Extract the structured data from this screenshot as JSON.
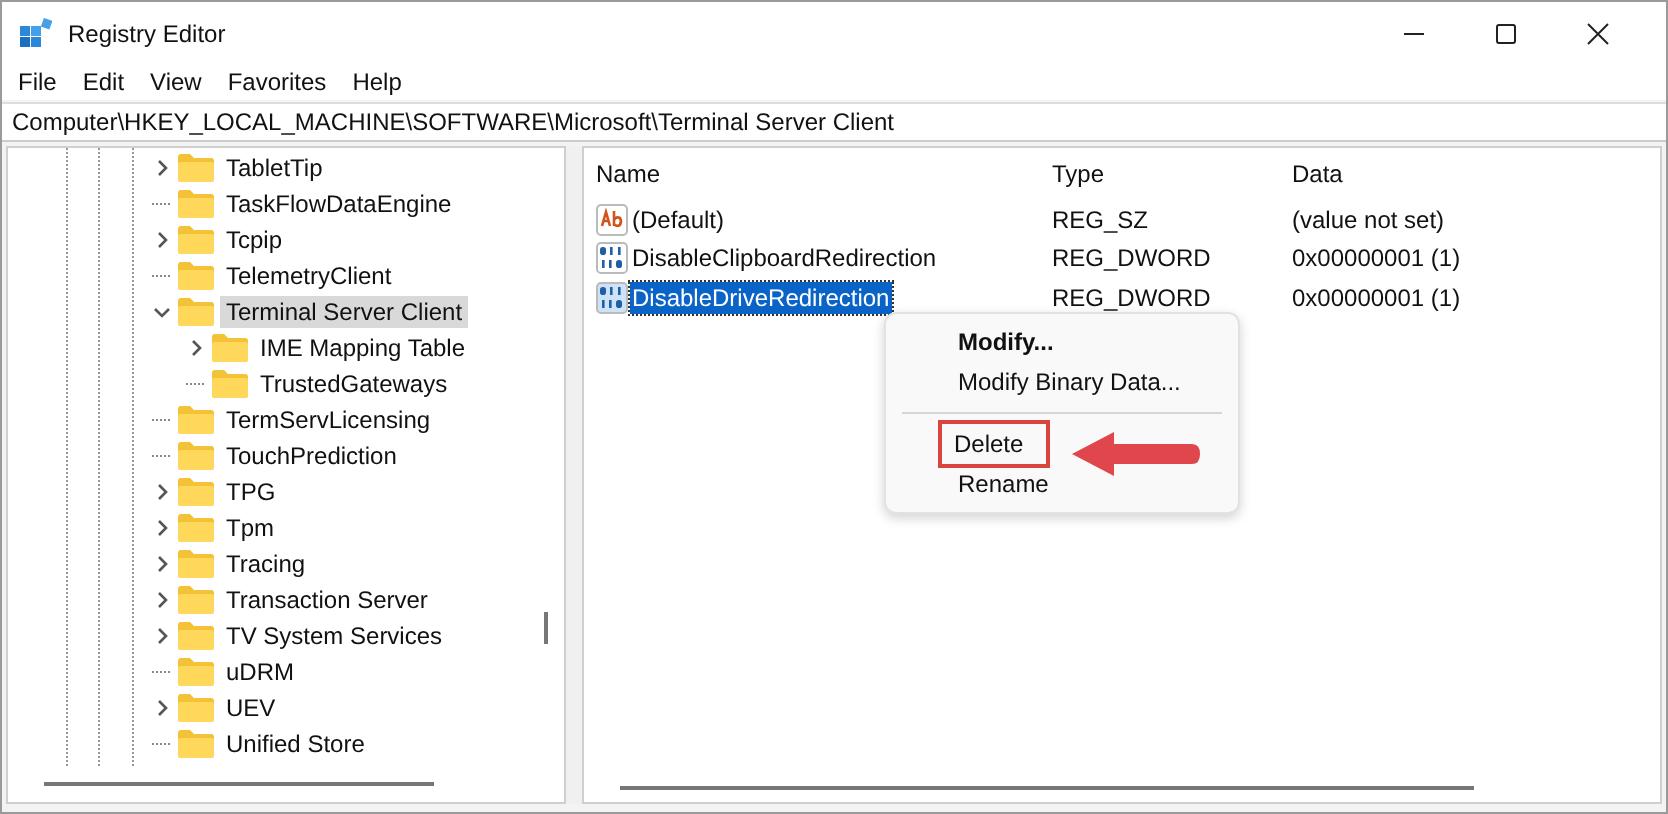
{
  "window": {
    "title": "Registry Editor"
  },
  "menu": [
    "File",
    "Edit",
    "View",
    "Favorites",
    "Help"
  ],
  "address": "Computer\\HKEY_LOCAL_MACHINE\\SOFTWARE\\Microsoft\\Terminal Server Client",
  "tree": [
    {
      "label": "TabletTip",
      "expandable": true,
      "expanded": false,
      "selected": false
    },
    {
      "label": "TaskFlowDataEngine",
      "expandable": false,
      "selected": false
    },
    {
      "label": "Tcpip",
      "expandable": true,
      "expanded": false,
      "selected": false
    },
    {
      "label": "TelemetryClient",
      "expandable": false,
      "selected": false
    },
    {
      "label": "Terminal Server Client",
      "expandable": true,
      "expanded": true,
      "selected": true,
      "children": [
        {
          "label": "IME Mapping Table",
          "expandable": true,
          "expanded": false,
          "selected": false
        },
        {
          "label": "TrustedGateways",
          "expandable": false,
          "selected": false
        }
      ]
    },
    {
      "label": "TermServLicensing",
      "expandable": false,
      "selected": false
    },
    {
      "label": "TouchPrediction",
      "expandable": false,
      "selected": false
    },
    {
      "label": "TPG",
      "expandable": true,
      "expanded": false,
      "selected": false
    },
    {
      "label": "Tpm",
      "expandable": true,
      "expanded": false,
      "selected": false
    },
    {
      "label": "Tracing",
      "expandable": true,
      "expanded": false,
      "selected": false
    },
    {
      "label": "Transaction Server",
      "expandable": true,
      "expanded": false,
      "selected": false
    },
    {
      "label": "TV System Services",
      "expandable": true,
      "expanded": false,
      "selected": false
    },
    {
      "label": "uDRM",
      "expandable": false,
      "selected": false
    },
    {
      "label": "UEV",
      "expandable": true,
      "expanded": false,
      "selected": false
    },
    {
      "label": "Unified Store",
      "expandable": false,
      "selected": false
    }
  ],
  "values": {
    "columns": [
      "Name",
      "Type",
      "Data"
    ],
    "rows": [
      {
        "name": "(Default)",
        "kind": "string",
        "type": "REG_SZ",
        "data": "(value not set)",
        "selected": false
      },
      {
        "name": "DisableClipboardRedirection",
        "kind": "binary",
        "type": "REG_DWORD",
        "data": "0x00000001 (1)",
        "selected": false
      },
      {
        "name": "DisableDriveRedirection",
        "kind": "binary",
        "type": "REG_DWORD",
        "data": "0x00000001 (1)",
        "selected": true
      }
    ]
  },
  "context_menu": [
    {
      "kind": "item",
      "label": "Modify...",
      "default": true,
      "highlighted": false
    },
    {
      "kind": "item",
      "label": "Modify Binary Data...",
      "default": false,
      "highlighted": false
    },
    {
      "kind": "separator"
    },
    {
      "kind": "item",
      "label": "Delete",
      "default": false,
      "highlighted": true
    },
    {
      "kind": "item",
      "label": "Rename",
      "default": false,
      "highlighted": false
    }
  ]
}
